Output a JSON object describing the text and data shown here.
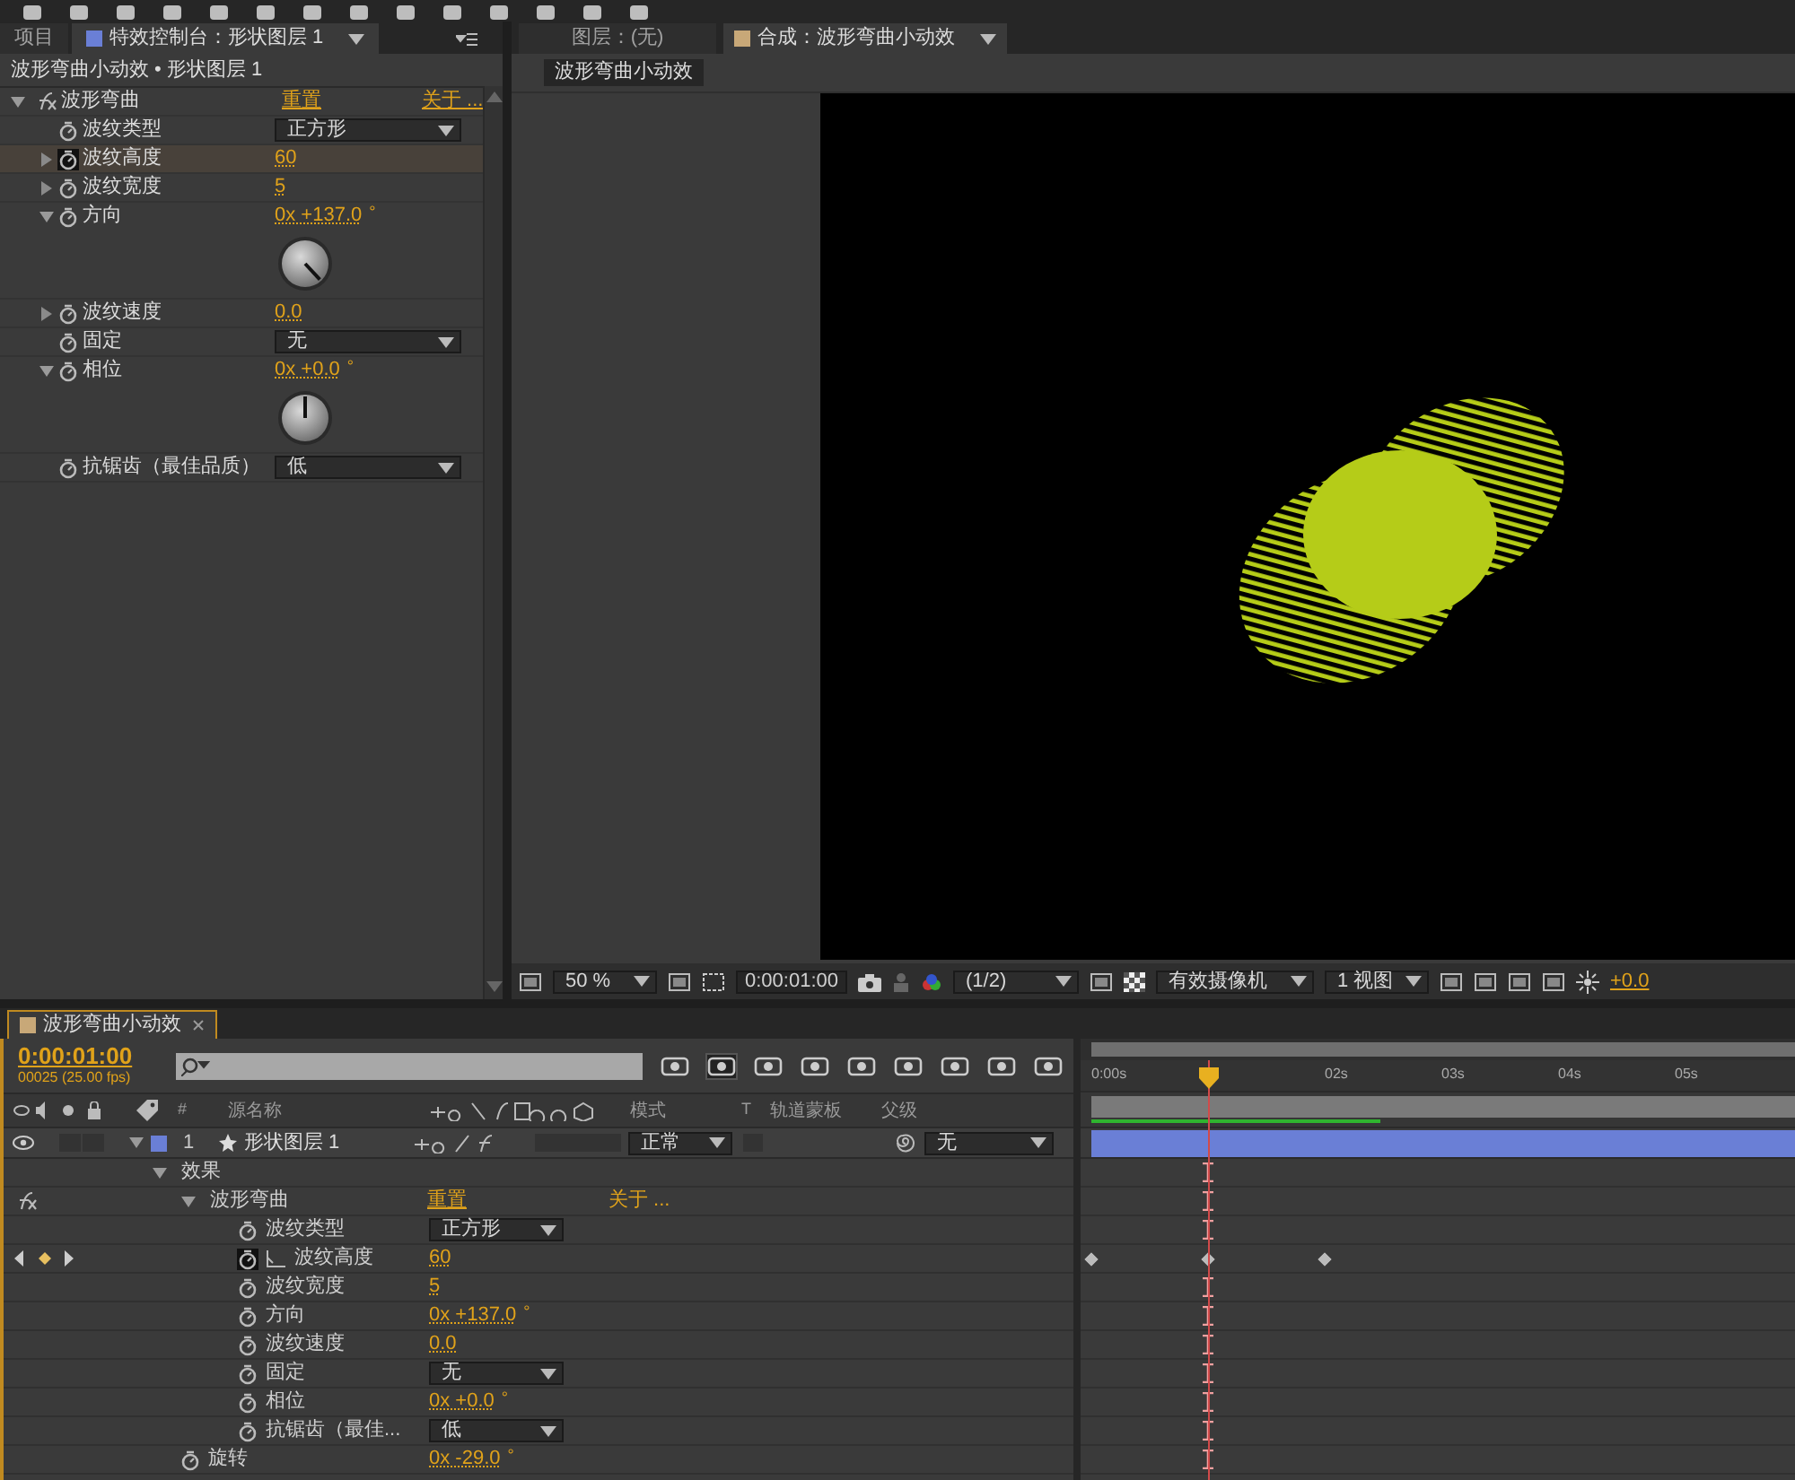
{
  "effect_controls": {
    "tabs": [
      {
        "label": "项目",
        "selected": false
      },
      {
        "label": "特效控制台：形状图层 1",
        "selected": true
      }
    ],
    "breadcrumb": "波形弯曲小动效 • 形状图层 1",
    "effect": {
      "name": "波形弯曲",
      "expanded": true,
      "reset": "重置",
      "about": "关于 ...",
      "properties": [
        {
          "label": "波纹类型",
          "kind": "dropdown",
          "value": "正方形",
          "selected": false,
          "keyframed": false
        },
        {
          "label": "波纹高度",
          "kind": "value",
          "value": "60",
          "expanded": false,
          "selected": true,
          "keyframed": true
        },
        {
          "label": "波纹宽度",
          "kind": "value",
          "value": "5",
          "expanded": false,
          "selected": false,
          "keyframed": false
        },
        {
          "label": "方向",
          "kind": "angle",
          "value": "0x +137.0",
          "unit": "°",
          "expanded": true,
          "selected": false,
          "keyframed": false
        },
        {
          "label": "波纹速度",
          "kind": "value",
          "value": "0.0",
          "expanded": false,
          "selected": false,
          "keyframed": false
        },
        {
          "label": "固定",
          "kind": "dropdown",
          "value": "无",
          "selected": false,
          "keyframed": false
        },
        {
          "label": "相位",
          "kind": "angle",
          "value": "0x +0.0",
          "unit": "°",
          "expanded": true,
          "selected": false,
          "keyframed": false
        },
        {
          "label": "抗锯齿（最佳品质）",
          "kind": "dropdown",
          "value": "低",
          "selected": false,
          "keyframed": false
        }
      ]
    }
  },
  "viewer": {
    "tabs": [
      {
        "label": "图层：(无)",
        "selected": false
      },
      {
        "label": "合成：波形弯曲小动效",
        "selected": true
      }
    ],
    "breadcrumb": "波形弯曲小动效",
    "zoom": "50 %",
    "timecode": "0:00:01:00",
    "resolution": "(1/2)",
    "camera": "有效摄像机",
    "views": "1 视图",
    "exposure": "+0.0"
  },
  "timeline": {
    "tab": "波形弯曲小动效",
    "timecode": "0:00:01:00",
    "fps": "00025 (25.00 fps)",
    "columns": {
      "number": "#",
      "source_name": "源名称",
      "mode": "模式",
      "t": "T",
      "track_matte": "轨道蒙板",
      "parent": "父级"
    },
    "ruler": [
      "0:00s",
      "02s",
      "03s",
      "04s",
      "05s"
    ],
    "playhead": {
      "level": 0.1658
    },
    "work_area": {
      "level": 0.41
    },
    "layer": {
      "number": "1",
      "name": "形状图层 1",
      "mode": "正常",
      "parent": "无",
      "color": "#6a7fd6",
      "visible": true,
      "expanded": true,
      "children": [
        {
          "label": "效果",
          "kind": "group",
          "expanded": true,
          "children": [
            {
              "label": "波形弯曲",
              "kind": "effect",
              "expanded": true,
              "reset": "重置",
              "about": "关于 ...",
              "children": [
                {
                  "label": "波纹类型",
                  "kind": "dropdown",
                  "value": "正方形",
                  "keyframed": false
                },
                {
                  "label": "波纹高度",
                  "kind": "value",
                  "value": "60",
                  "keyframed": true,
                  "keyframes": [
                    {
                      "level": 0
                    },
                    {
                      "level": 0.1658
                    },
                    {
                      "level": 0.3316
                    }
                  ]
                },
                {
                  "label": "波纹宽度",
                  "kind": "value",
                  "value": "5",
                  "keyframed": false
                },
                {
                  "label": "方向",
                  "kind": "value",
                  "value": "0x +137.0",
                  "unit": "°",
                  "keyframed": false
                },
                {
                  "label": "波纹速度",
                  "kind": "value",
                  "value": "0.0",
                  "keyframed": false
                },
                {
                  "label": "固定",
                  "kind": "dropdown",
                  "value": "无",
                  "keyframed": false
                },
                {
                  "label": "相位",
                  "kind": "value",
                  "value": "0x +0.0",
                  "unit": "°",
                  "keyframed": false
                },
                {
                  "label": "抗锯齿（最佳...",
                  "kind": "dropdown",
                  "value": "低",
                  "keyframed": false
                }
              ]
            }
          ]
        },
        {
          "label": "旋转",
          "kind": "value",
          "value": "0x -29.0",
          "unit": "°",
          "keyframed": false
        }
      ]
    }
  }
}
